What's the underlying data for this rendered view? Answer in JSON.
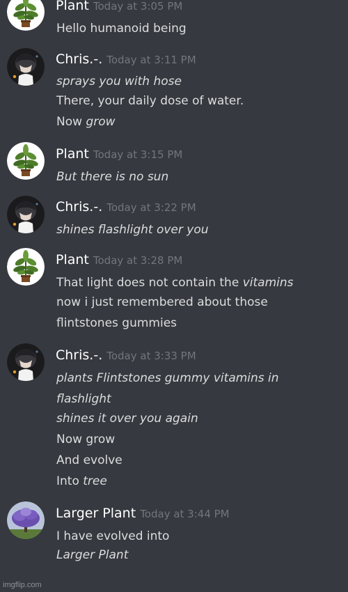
{
  "messages": [
    {
      "author": "Plant",
      "timestamp": "Today at 3:05 PM",
      "lines": [
        [
          {
            "t": "Hello humanoid being",
            "i": false
          }
        ]
      ]
    },
    {
      "author": "Chris.-.",
      "timestamp": "Today at 3:11 PM",
      "lines": [
        [
          {
            "t": "sprays you with hose",
            "i": true
          }
        ],
        [
          {
            "t": "There, your daily dose of water.",
            "i": false
          }
        ],
        [
          {
            "t": "Now ",
            "i": false
          },
          {
            "t": "grow",
            "i": true
          }
        ]
      ]
    },
    {
      "author": "Plant",
      "timestamp": "Today at 3:15 PM",
      "lines": [
        [
          {
            "t": "But there is no sun",
            "i": true
          }
        ]
      ]
    },
    {
      "author": "Chris.-.",
      "timestamp": "Today at 3:22 PM",
      "lines": [
        [
          {
            "t": "shines flashlight over you",
            "i": true
          }
        ]
      ]
    },
    {
      "author": "Plant",
      "timestamp": "Today at 3:28 PM",
      "lines": [
        [
          {
            "t": "That light does not contain the ",
            "i": false
          },
          {
            "t": "vitamins",
            "i": true
          }
        ],
        [
          {
            "t": "now i just remembered about those",
            "i": false
          }
        ],
        [
          {
            "t": "flintstones gummies",
            "i": false
          }
        ]
      ]
    },
    {
      "author": "Chris.-.",
      "timestamp": "Today at 3:33 PM",
      "lines": [
        [
          {
            "t": "plants Flintstones gummy vitamins in",
            "i": true
          }
        ],
        [
          {
            "t": "flashlight",
            "i": true
          }
        ],
        [
          {
            "t": "shines it over you again",
            "i": true
          }
        ],
        [
          {
            "t": "Now grow",
            "i": false
          }
        ],
        [
          {
            "t": "And evolve",
            "i": false
          }
        ],
        [
          {
            "t": "Into ",
            "i": false
          },
          {
            "t": "tree",
            "i": true
          }
        ]
      ]
    },
    {
      "author": "Larger Plant",
      "timestamp": "Today at 3:44 PM",
      "lines": [
        [
          {
            "t": "I have evolved into",
            "i": false
          }
        ],
        [
          {
            "t": "Larger Plant",
            "i": true
          }
        ]
      ]
    }
  ],
  "watermark": "imgflip.com",
  "colors": {
    "background": "#36393f",
    "username": "#ffffff",
    "timestamp": "#72767d",
    "text": "#dcddde"
  },
  "avatars": [
    "plant-avatar",
    "chris-avatar",
    "plant-avatar",
    "chris-avatar",
    "plant-avatar",
    "chris-avatar",
    "larger-plant-avatar"
  ]
}
